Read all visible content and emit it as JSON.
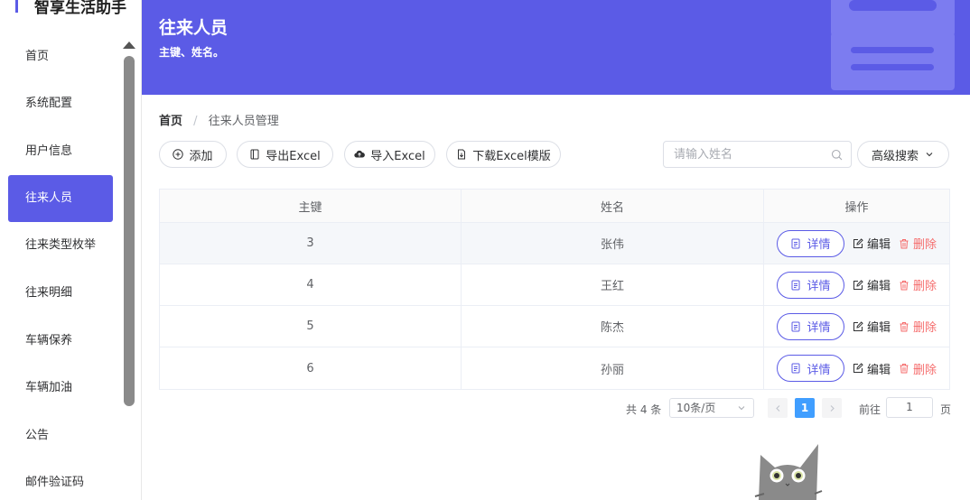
{
  "app": {
    "title": "智享生活助手"
  },
  "sidebar": {
    "items": [
      {
        "label": "首页"
      },
      {
        "label": "系统配置"
      },
      {
        "label": "用户信息"
      },
      {
        "label": "往来人员",
        "active": true
      },
      {
        "label": "往来类型枚举"
      },
      {
        "label": "往来明细"
      },
      {
        "label": "车辆保养"
      },
      {
        "label": "车辆加油"
      },
      {
        "label": "公告"
      },
      {
        "label": "邮件验证码"
      }
    ]
  },
  "header": {
    "title": "往来人员",
    "subtitle": "主键、姓名。"
  },
  "breadcrumb": {
    "home": "首页",
    "separator": "/",
    "current": "往来人员管理"
  },
  "toolbar": {
    "add": "添加",
    "export": "导出Excel",
    "import": "导入Excel",
    "download_template": "下载Excel模版",
    "search_placeholder": "请输入姓名",
    "advanced_search": "高级搜索"
  },
  "table": {
    "columns": [
      "主键",
      "姓名",
      "操作"
    ],
    "rows": [
      {
        "id": "3",
        "name": "张伟"
      },
      {
        "id": "4",
        "name": "王红"
      },
      {
        "id": "5",
        "name": "陈杰"
      },
      {
        "id": "6",
        "name": "孙丽"
      }
    ],
    "actions": {
      "detail": "详情",
      "edit": "编辑",
      "delete": "删除"
    }
  },
  "pagination": {
    "total_text": "共 4 条",
    "page_size": "10条/页",
    "current_page": "1",
    "goto_label": "前往",
    "goto_value": "1",
    "page_suffix": "页"
  },
  "colors": {
    "primary": "#5b5be6",
    "danger": "#f56c6c",
    "page_active": "#409eff"
  }
}
